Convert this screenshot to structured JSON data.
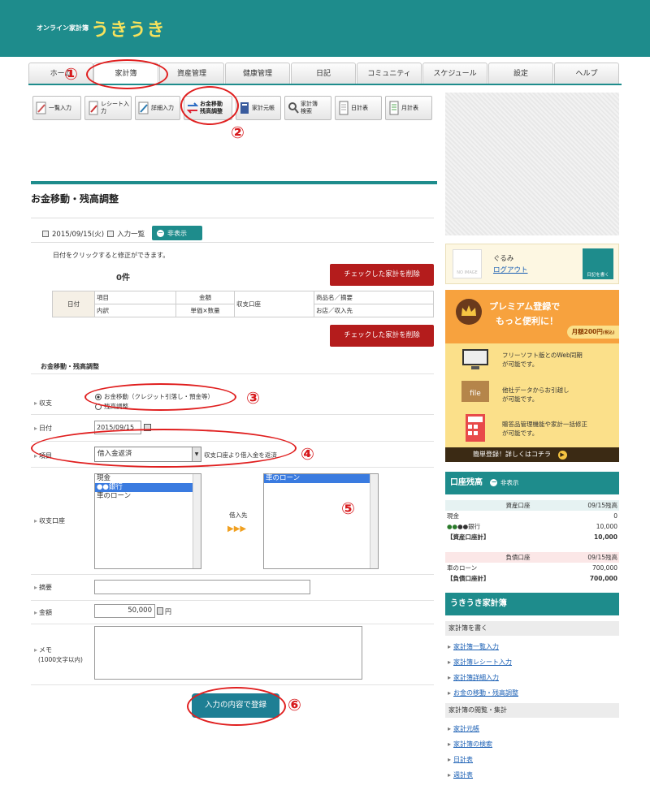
{
  "header": {
    "tagline": "オンライン家計簿",
    "logo": "うきうき"
  },
  "nav": {
    "tabs": [
      "ホーム",
      "家計簿",
      "資産管理",
      "健康管理",
      "日記",
      "コミュニティ",
      "スケジュール",
      "設定",
      "ヘルプ"
    ]
  },
  "toolbar": {
    "items": [
      "一覧入力",
      "レシート入力",
      "詳細入力",
      "お金移動\n残高調整",
      "家計元帳",
      "家計簿\n検索",
      "日計表",
      "月計表"
    ]
  },
  "annotations": [
    "①",
    "②",
    "③",
    "④",
    "⑤",
    "⑥"
  ],
  "page": {
    "title": "お金移動・残高調整",
    "date_link": "2015/09/15(火)",
    "list_link": "入力一覧",
    "hide_button": "非表示",
    "hint": "日付をクリックすると修正ができます。",
    "count": "0件",
    "delete_button": "チェックした家計を削除",
    "table": {
      "date": "日付",
      "item": "項目",
      "subitem": "内訳",
      "amount": "金額",
      "unit": "単価×数量",
      "account": "収支口座",
      "product": "商品名／摘要",
      "shop": "お店／収入先"
    }
  },
  "form": {
    "section_title": "お金移動・残高調整",
    "type_label": "収支",
    "type_options": [
      "お金移動（クレジット引落し・預金等）",
      "残高調整"
    ],
    "date_label": "日付",
    "date_value": "2015/09/15",
    "item_label": "項目",
    "item_value": "借入金返済",
    "item_note": "収支口座より借入金を返済",
    "account_label": "収支口座",
    "from_accounts": [
      "現金",
      "●●銀行",
      "車のローン"
    ],
    "arrow": "▶▶▶",
    "to_label": "借入先",
    "to_accounts": [
      "車のローン"
    ],
    "summary_label": "摘要",
    "amount_label": "金額",
    "amount_value": "50,000",
    "amount_unit": "円",
    "memo_label": "メモ",
    "memo_note": "(1000文字以内)",
    "submit": "入力の内容で登録"
  },
  "user": {
    "name": "ぐるみ",
    "logout": "ログアウト",
    "diary": "日記を書く",
    "no_image": "NO IMAGE"
  },
  "premium": {
    "title1": "プレミアム登録で",
    "title2": "もっと便利に！",
    "price": "月額200円",
    "price_note": "(税込)",
    "features": [
      [
        "フリーソフト版とのWeb同期",
        "が可能です。"
      ],
      [
        "他社データからお引越し",
        "が可能です。"
      ],
      [
        "贈答品管理機能や家計一括修正",
        "が可能です。"
      ]
    ],
    "file_icon_text": "file",
    "cta": "簡単登録！詳しくはコチラ"
  },
  "balance": {
    "title": "口座残高",
    "hide": "非表示",
    "asset_head": "資産口座",
    "asset_date": "09/15残高",
    "assets": [
      [
        "現金",
        "0"
      ],
      [
        "●●銀行",
        "10,000"
      ]
    ],
    "asset_total": [
      "【資産口座計】",
      "10,000"
    ],
    "debt_head": "負債口座",
    "debt_date": "09/15残高",
    "debts": [
      [
        "車のローン",
        "700,000"
      ]
    ],
    "debt_total": [
      "【負債口座計】",
      "700,000"
    ]
  },
  "sidebar": {
    "title": "うきうき家計簿",
    "write_head": "家計簿を書く",
    "write_links": [
      "家計簿一覧入力",
      "家計簿レシート入力",
      "家計簿詳細入力",
      "お金の移動・残高調整"
    ],
    "view_head": "家計簿の閲覧・集計",
    "view_links": [
      "家計元帳",
      "家計簿の検索",
      "日計表",
      "週計表"
    ]
  },
  "colors": {
    "brand": "#1e8c8c",
    "logo": "#f6e25c",
    "danger": "#b41c1c",
    "annotation": "#e01f1f"
  }
}
